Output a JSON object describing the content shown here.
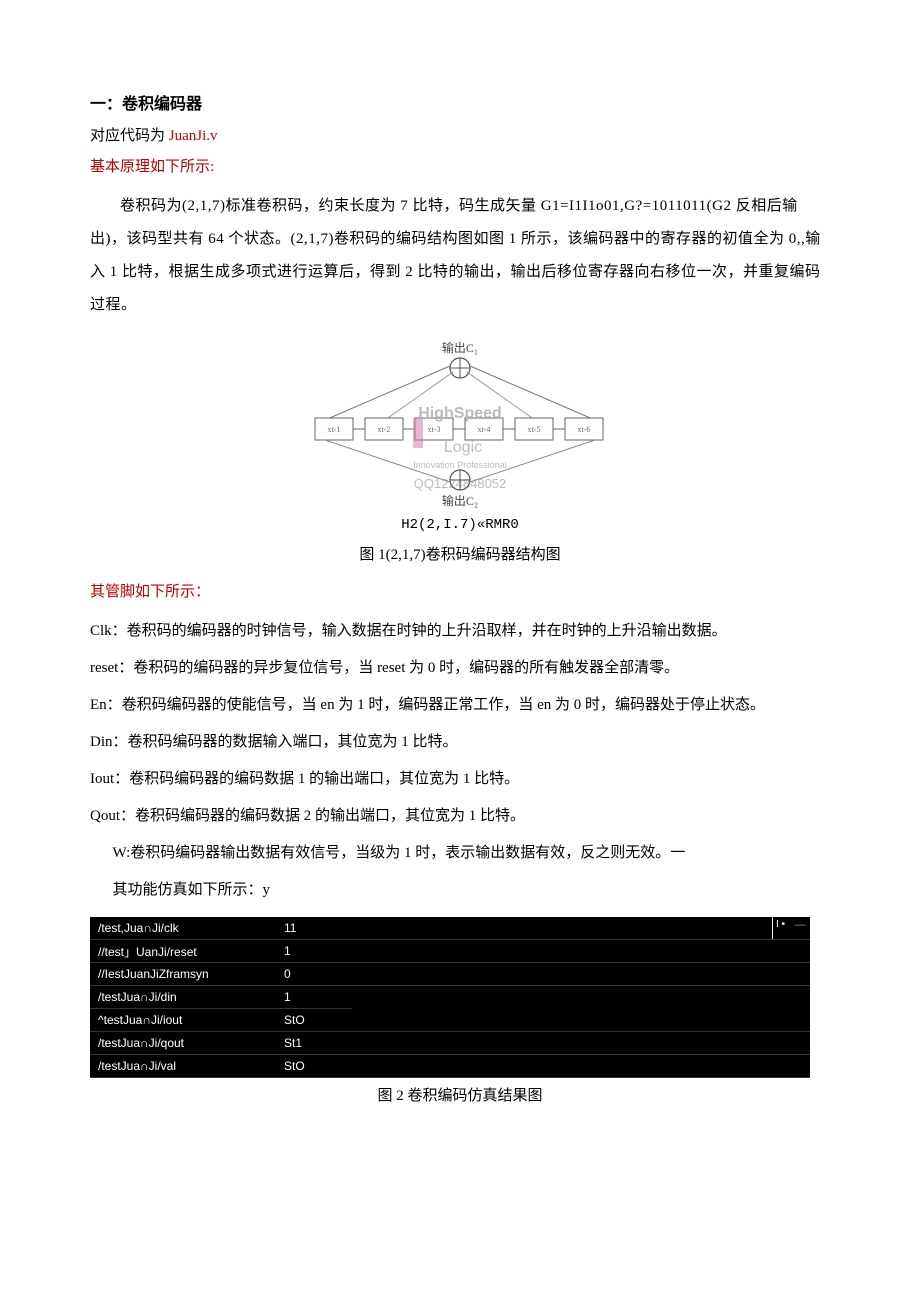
{
  "heading": "一：卷积编码器",
  "line2_prefix": "对应代码为 ",
  "line2_code": "JuanJi.v",
  "principle": "基本原理如下所示:",
  "para1": "卷积码为(2,1,7)标准卷积码，约束长度为 7 比特，码生成矢量 G1=I1I1o01,G?=1011011(G2 反相后输出)，该码型共有 64 个状态。(2,1,7)卷积码的编码结构图如图 1 所示，该编码器中的寄存器的初值全为 0,,输入 1 比特，根据生成多项式进行运算后，得到 2 比特的输出，输出后移位寄存器向右移位一次，并重复编码过程。",
  "fig1": {
    "top_label": "输出C₁",
    "wm1": "HighSpeed",
    "wm2": "Logic",
    "wm3": "Innovation    Professional",
    "wm4": "QQ1224848052",
    "bot_label": "输出C₂",
    "box_prefix": "xt-",
    "boxes": [
      "1",
      "2",
      "3",
      "4",
      "5",
      "6"
    ],
    "formula": "H2(2,I.7)«RMR0",
    "caption": "图 1(2,1,7)卷积码编码器结构图"
  },
  "pins_head": "其管脚如下所示：",
  "pins": [
    "Clk：卷积码的编码器的时钟信号，输入数据在时钟的上升沿取样，并在时钟的上升沿输出数据。",
    "reset：卷积码的编码器的异步复位信号，当 reset 为 0 时，编码器的所有触发器全部清零。",
    "En：卷积码编码器的使能信号，当 en 为 1 时，编码器正常工作，当 en 为 0 时，编码器处于停止状态。",
    "Din：卷积码编码器的数据输入端口，其位宽为 1 比特。",
    "Iout：卷积码编码器的编码数据 1 的输出端口，其位宽为 1 比特。",
    "Qout：卷积码编码器的编码数据 2 的输出端口，其位宽为 1 比特。"
  ],
  "pins_ind1": "W:卷积码编码器输出数据有效信号，当级为 1 时，表示输出数据有效，反之则无效。一",
  "pins_ind2": "其功能仿真如下所示：y",
  "sim": {
    "rows": [
      {
        "name": "/test,Jua∩Ji/clk",
        "val": "11"
      },
      {
        "name": "//test」UanJi/reset",
        "val": "1"
      },
      {
        "name": "//IestJuanJiZframsyn",
        "val": "0"
      },
      {
        "name": "/testJua∩Ji/din",
        "val": "1"
      },
      {
        "name": "^testJua∩Ji/iout",
        "val": "StO"
      },
      {
        "name": "/testJua∩Ji/qout",
        "val": "St1"
      },
      {
        "name": "/testJua∩Ji/val",
        "val": "StO"
      }
    ],
    "cursor_mark": "I •",
    "dash": "—"
  },
  "fig2_caption": "图 2 卷积编码仿真结果图"
}
